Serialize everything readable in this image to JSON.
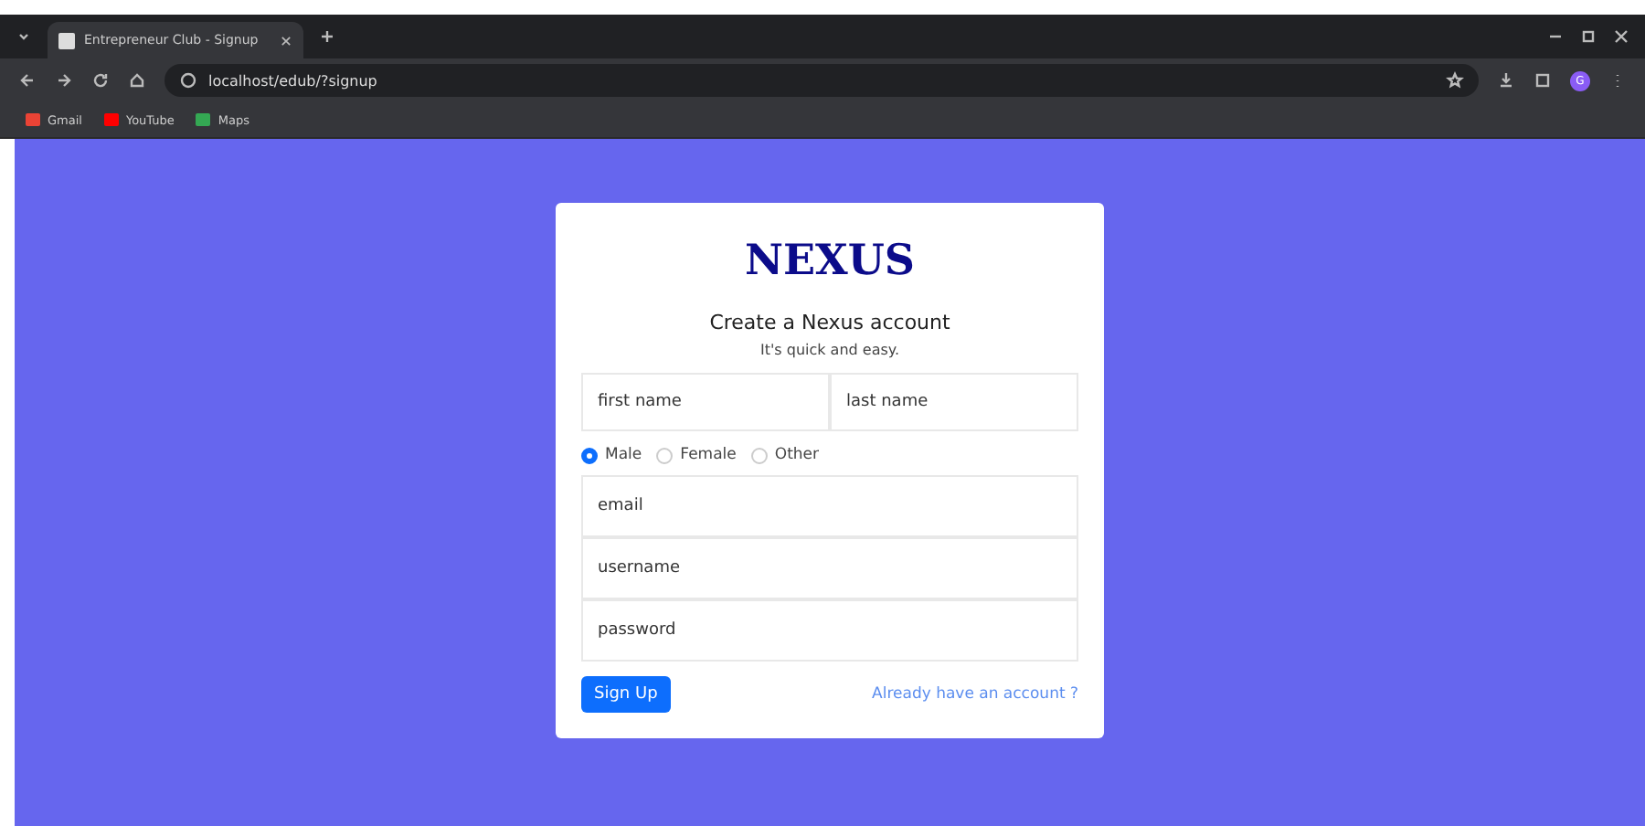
{
  "browser": {
    "tab_title": "Entrepreneur Club - Signup",
    "url": "localhost/edub/?signup",
    "bookmarks": [
      "Gmail",
      "YouTube",
      "Maps"
    ],
    "profile_initial": "G"
  },
  "form": {
    "logo": "NEXUS",
    "heading": "Create a Nexus account",
    "subheading": "It's quick and easy.",
    "name_fields": [
      {
        "placeholder": "first name"
      },
      {
        "placeholder": "last name"
      }
    ],
    "genders": [
      {
        "label": "Male",
        "selected": true
      },
      {
        "label": "Female",
        "selected": false
      },
      {
        "label": "Other",
        "selected": false
      }
    ],
    "fields": [
      {
        "placeholder": "email"
      },
      {
        "placeholder": "username"
      },
      {
        "placeholder": "password"
      }
    ],
    "submit": "Sign Up",
    "login_link": "Already have an account ?"
  }
}
